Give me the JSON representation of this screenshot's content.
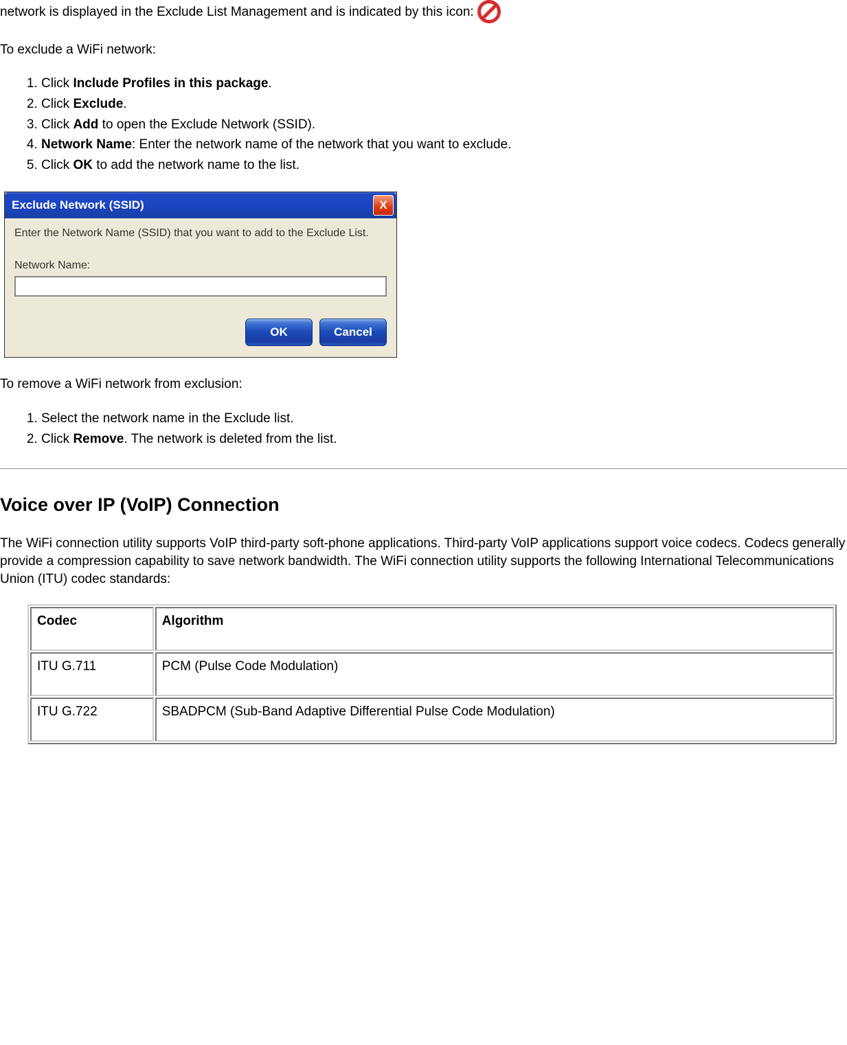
{
  "intro_para": "network is displayed in the Exclude List Management and is indicated by this icon:",
  "exclude_heading": "To exclude a WiFi network:",
  "steps_exclude": [
    {
      "pre": "Click ",
      "bold": "Include Profiles in this package",
      "post": "."
    },
    {
      "pre": "Click ",
      "bold": "Exclude",
      "post": "."
    },
    {
      "pre": "Click ",
      "bold": "Add",
      "post": " to open the Exclude Network (SSID)."
    },
    {
      "pre": "",
      "bold": "Network Name",
      "post": ": Enter the network name of the network that you want to exclude."
    },
    {
      "pre": "Click ",
      "bold": "OK",
      "post": " to add the network name to the list."
    }
  ],
  "dialog": {
    "title": "Exclude Network (SSID)",
    "instruction": "Enter the Network Name (SSID) that you want to add to the Exclude List.",
    "label": "Network Name:",
    "input_value": "",
    "ok_label": "OK",
    "cancel_label": "Cancel",
    "close_label": "X"
  },
  "remove_heading": "To remove a WiFi network from exclusion:",
  "steps_remove": [
    {
      "text": "Select the network name in the Exclude list."
    },
    {
      "pre": "Click ",
      "bold": "Remove",
      "post": ". The network is deleted from the list."
    }
  ],
  "voip_heading": "Voice over IP (VoIP) Connection",
  "voip_para": "The WiFi connection utility supports VoIP third-party soft-phone applications. Third-party VoIP applications support voice codecs. Codecs generally provide a compression capability to save network bandwidth. The WiFi connection utility supports the following International Telecommunications Union (ITU) codec standards:",
  "table": {
    "header_codec": "Codec",
    "header_algo": "Algorithm",
    "rows": [
      {
        "codec": "ITU G.711",
        "algo": "PCM (Pulse Code Modulation)"
      },
      {
        "codec": "ITU G.722",
        "algo": "SBADPCM (Sub-Band Adaptive Differential Pulse Code Modulation)"
      }
    ]
  }
}
